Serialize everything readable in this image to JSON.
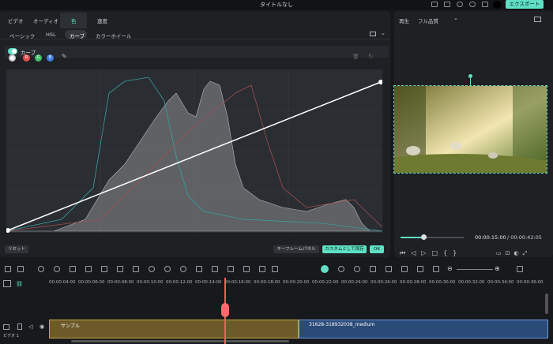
{
  "app": {
    "title": "タイトルなし",
    "export_label": "エクスポート"
  },
  "tabs": [
    "ビデオ",
    "オーディオ",
    "色",
    "速度"
  ],
  "subtabs": [
    "ベーシック",
    "HSL",
    "カーブ",
    "カラーホイール"
  ],
  "curve_toggle_label": "カーブ",
  "channels": [
    {
      "label": "",
      "color": "#ffffff"
    },
    {
      "label": "R",
      "color": "#e05050"
    },
    {
      "label": "G",
      "color": "#3fbf6a"
    },
    {
      "label": "B",
      "color": "#3f7fe0"
    }
  ],
  "buttons": {
    "reset": "リセット",
    "keyframe": "キーフレームパネル",
    "save_custom": "カスタムとして保存",
    "ok": "OK"
  },
  "preview": {
    "label": "再生",
    "quality": "フル品質",
    "current_time": "00:00:15:00",
    "total_time": "/ 00:00:42:05",
    "progress": 0.36
  },
  "timeline": {
    "ticks": [
      "00:00:04:00",
      "00:00:06:00",
      "00:00:08:00",
      "00:00:10:00",
      "00:00:12:00",
      "00:00:14:00",
      "00:00:16:00",
      "00:00:18:00",
      "00:00:20:00",
      "00:00:22:00",
      "00:00:24:00",
      "00:00:26:00",
      "00:00:28:00",
      "00:00:30:00",
      "00:00:32:00",
      "00:00:34:00",
      "00:00:36:00"
    ],
    "clip1": "サンプル",
    "clip2": "31628-318932038_medium",
    "track_label": "ビデオ 1"
  }
}
